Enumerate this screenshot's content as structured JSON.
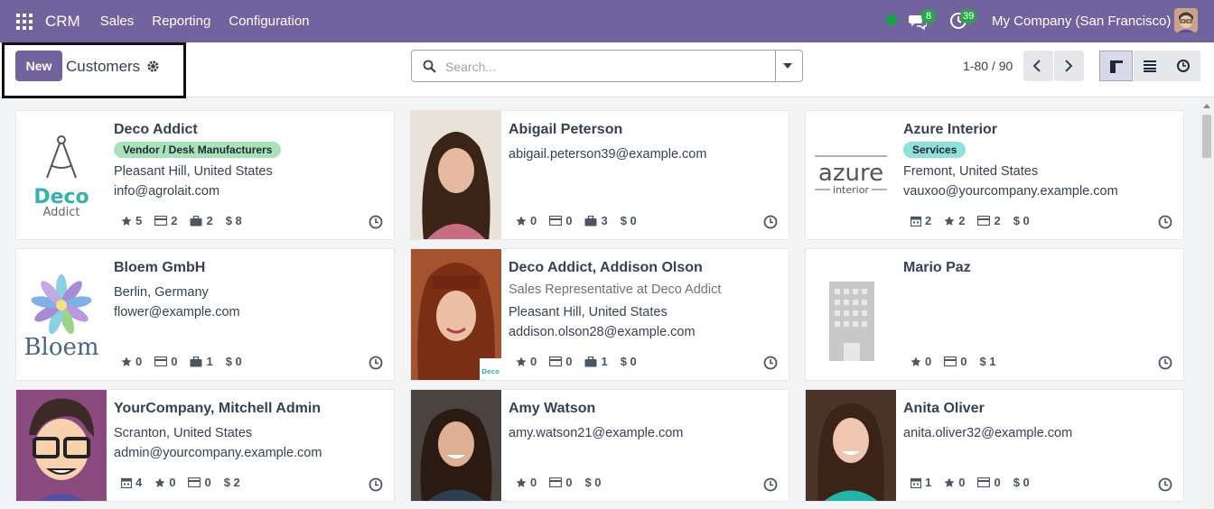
{
  "topbar": {
    "app_name": "CRM",
    "menu": [
      "Sales",
      "Reporting",
      "Configuration"
    ],
    "messages_count": "8",
    "activities_count": "39",
    "company": "My Company (San Francisco)"
  },
  "control": {
    "new_label": "New",
    "title": "Customers",
    "search_placeholder": "Search...",
    "pager": "1-80 / 90"
  },
  "colors": {
    "brand": "#71639e",
    "tag_green": "#a7e3b7",
    "tag_teal": "#8fe1d9",
    "online": "#16a34a",
    "badge": "#28a745"
  },
  "cards": [
    {
      "name": "Deco Addict",
      "tag": "Vendor / Desk Manufacturers",
      "line1": "Pleasant Hill, United States",
      "line2": "info@agrolait.com",
      "stats": [
        {
          "icon": "star-icon",
          "value": "5"
        },
        {
          "icon": "card-icon",
          "value": "2"
        },
        {
          "icon": "briefcase-icon",
          "value": "2"
        },
        {
          "icon": "dollar-icon",
          "value": "$ 8"
        }
      ]
    },
    {
      "name": "Abigail Peterson",
      "line1": "abigail.peterson39@example.com",
      "stats": [
        {
          "icon": "star-icon",
          "value": "0"
        },
        {
          "icon": "card-icon",
          "value": "0"
        },
        {
          "icon": "briefcase-icon",
          "value": "3"
        },
        {
          "icon": "dollar-icon",
          "value": "$ 0"
        }
      ]
    },
    {
      "name": "Azure Interior",
      "tag": "Services",
      "line1": "Fremont, United States",
      "line2": "vauxoo@yourcompany.example.com",
      "stats": [
        {
          "icon": "calendar-icon",
          "value": "2"
        },
        {
          "icon": "star-icon",
          "value": "2"
        },
        {
          "icon": "card-icon",
          "value": "2"
        },
        {
          "icon": "dollar-icon",
          "value": "$ 0"
        }
      ]
    },
    {
      "name": "Bloem GmbH",
      "line1": "Berlin, Germany",
      "line2": "flower@example.com",
      "stats": [
        {
          "icon": "star-icon",
          "value": "0"
        },
        {
          "icon": "card-icon",
          "value": "0"
        },
        {
          "icon": "briefcase-icon",
          "value": "1"
        },
        {
          "icon": "dollar-icon",
          "value": "$ 0"
        }
      ]
    },
    {
      "name": "Deco Addict, Addison Olson",
      "subtitle": "Sales Representative at Deco Addict",
      "line1": "Pleasant Hill, United States",
      "line2": "addison.olson28@example.com",
      "stats": [
        {
          "icon": "star-icon",
          "value": "0"
        },
        {
          "icon": "card-icon",
          "value": "0"
        },
        {
          "icon": "briefcase-icon",
          "value": "1"
        },
        {
          "icon": "dollar-icon",
          "value": "$ 0"
        }
      ]
    },
    {
      "name": "Mario Paz",
      "stats": [
        {
          "icon": "star-icon",
          "value": "0"
        },
        {
          "icon": "card-icon",
          "value": "0"
        },
        {
          "icon": "dollar-icon",
          "value": "$ 1"
        }
      ]
    },
    {
      "name": "YourCompany, Mitchell Admin",
      "line1": "Scranton, United States",
      "line2": "admin@yourcompany.example.com",
      "stats": [
        {
          "icon": "calendar-icon",
          "value": "4"
        },
        {
          "icon": "star-icon",
          "value": "0"
        },
        {
          "icon": "card-icon",
          "value": "0"
        },
        {
          "icon": "dollar-icon",
          "value": "$ 2"
        }
      ]
    },
    {
      "name": "Amy Watson",
      "line1": "amy.watson21@example.com",
      "stats": [
        {
          "icon": "star-icon",
          "value": "0"
        },
        {
          "icon": "card-icon",
          "value": "0"
        },
        {
          "icon": "dollar-icon",
          "value": "$ 0"
        }
      ]
    },
    {
      "name": "Anita Oliver",
      "line1": "anita.oliver32@example.com",
      "stats": [
        {
          "icon": "calendar-icon",
          "value": "1"
        },
        {
          "icon": "star-icon",
          "value": "0"
        },
        {
          "icon": "card-icon",
          "value": "0"
        },
        {
          "icon": "dollar-icon",
          "value": "$ 0"
        }
      ]
    }
  ],
  "logos": {
    "deco_main": "Deco",
    "deco_sub": "Addict",
    "azure_main": "azure",
    "azure_sub": "interior",
    "bloem": "Bloem",
    "deco_small": "Deco"
  }
}
